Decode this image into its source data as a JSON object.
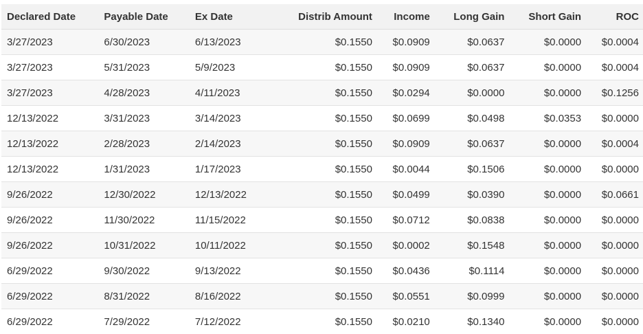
{
  "columns": {
    "declared_date": "Declared Date",
    "payable_date": "Payable Date",
    "ex_date": "Ex Date",
    "distrib_amount": "Distrib Amount",
    "income": "Income",
    "long_gain": "Long Gain",
    "short_gain": "Short Gain",
    "roc": "ROC"
  },
  "rows": [
    {
      "declared": "3/27/2023",
      "payable": "6/30/2023",
      "ex": "6/13/2023",
      "amount": "$0.1550",
      "income": "$0.0909",
      "long_gain": "$0.0637",
      "short_gain": "$0.0000",
      "roc": "$0.0004"
    },
    {
      "declared": "3/27/2023",
      "payable": "5/31/2023",
      "ex": "5/9/2023",
      "amount": "$0.1550",
      "income": "$0.0909",
      "long_gain": "$0.0637",
      "short_gain": "$0.0000",
      "roc": "$0.0004"
    },
    {
      "declared": "3/27/2023",
      "payable": "4/28/2023",
      "ex": "4/11/2023",
      "amount": "$0.1550",
      "income": "$0.0294",
      "long_gain": "$0.0000",
      "short_gain": "$0.0000",
      "roc": "$0.1256"
    },
    {
      "declared": "12/13/2022",
      "payable": "3/31/2023",
      "ex": "3/14/2023",
      "amount": "$0.1550",
      "income": "$0.0699",
      "long_gain": "$0.0498",
      "short_gain": "$0.0353",
      "roc": "$0.0000"
    },
    {
      "declared": "12/13/2022",
      "payable": "2/28/2023",
      "ex": "2/14/2023",
      "amount": "$0.1550",
      "income": "$0.0909",
      "long_gain": "$0.0637",
      "short_gain": "$0.0000",
      "roc": "$0.0004"
    },
    {
      "declared": "12/13/2022",
      "payable": "1/31/2023",
      "ex": "1/17/2023",
      "amount": "$0.1550",
      "income": "$0.0044",
      "long_gain": "$0.1506",
      "short_gain": "$0.0000",
      "roc": "$0.0000"
    },
    {
      "declared": "9/26/2022",
      "payable": "12/30/2022",
      "ex": "12/13/2022",
      "amount": "$0.1550",
      "income": "$0.0499",
      "long_gain": "$0.0390",
      "short_gain": "$0.0000",
      "roc": "$0.0661"
    },
    {
      "declared": "9/26/2022",
      "payable": "11/30/2022",
      "ex": "11/15/2022",
      "amount": "$0.1550",
      "income": "$0.0712",
      "long_gain": "$0.0838",
      "short_gain": "$0.0000",
      "roc": "$0.0000"
    },
    {
      "declared": "9/26/2022",
      "payable": "10/31/2022",
      "ex": "10/11/2022",
      "amount": "$0.1550",
      "income": "$0.0002",
      "long_gain": "$0.1548",
      "short_gain": "$0.0000",
      "roc": "$0.0000"
    },
    {
      "declared": "6/29/2022",
      "payable": "9/30/2022",
      "ex": "9/13/2022",
      "amount": "$0.1550",
      "income": "$0.0436",
      "long_gain": "$0.1114",
      "short_gain": "$0.0000",
      "roc": "$0.0000"
    },
    {
      "declared": "6/29/2022",
      "payable": "8/31/2022",
      "ex": "8/16/2022",
      "amount": "$0.1550",
      "income": "$0.0551",
      "long_gain": "$0.0999",
      "short_gain": "$0.0000",
      "roc": "$0.0000"
    },
    {
      "declared": "6/29/2022",
      "payable": "7/29/2022",
      "ex": "7/12/2022",
      "amount": "$0.1550",
      "income": "$0.0210",
      "long_gain": "$0.1340",
      "short_gain": "$0.0000",
      "roc": "$0.0000"
    }
  ]
}
